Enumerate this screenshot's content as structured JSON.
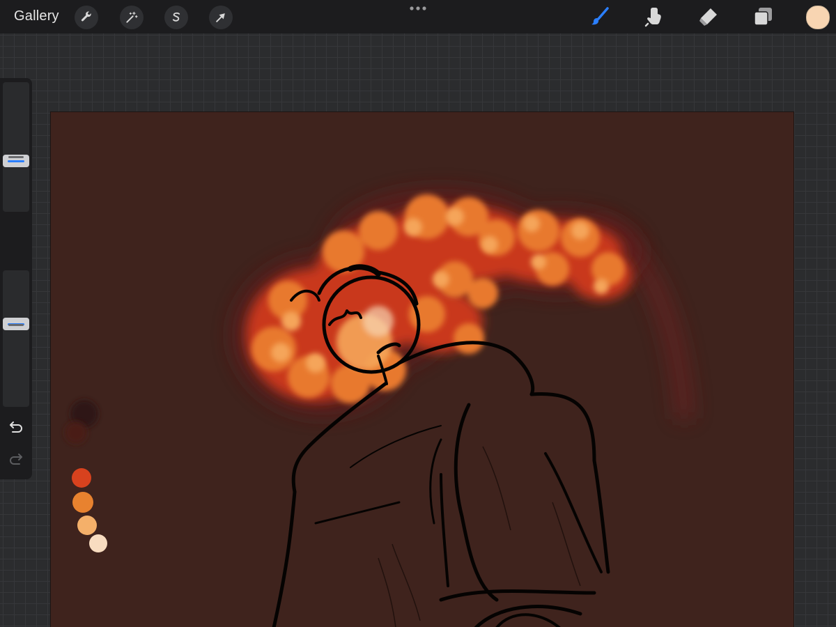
{
  "app": {
    "gallery_label": "Gallery"
  },
  "toolbar": {
    "left_buttons": [
      {
        "name": "actions",
        "icon": "wrench-icon"
      },
      {
        "name": "adjustments",
        "icon": "magic-wand-icon"
      },
      {
        "name": "selection",
        "icon": "selection-s-icon"
      },
      {
        "name": "transform",
        "icon": "arrow-cursor-icon"
      }
    ],
    "right_tools": [
      {
        "name": "brush",
        "icon": "brush-icon",
        "active": true
      },
      {
        "name": "smudge",
        "icon": "smudge-finger-icon",
        "active": false
      },
      {
        "name": "eraser",
        "icon": "eraser-icon",
        "active": false
      },
      {
        "name": "layers",
        "icon": "layers-icon",
        "active": false
      }
    ],
    "current_color": "#f8d5b2"
  },
  "sidebar": {
    "brush_size_level": 0.38,
    "opacity_level": 0.62,
    "modify_button_icon": "square-icon",
    "undo_icon": "undo-icon",
    "redo_icon": "redo-icon"
  },
  "colors": {
    "accent": "#2b7fff",
    "canvas_background": "#3f231d",
    "flame_colors": [
      "#c9391a",
      "#e8792f",
      "#f5a55a",
      "#f8d5b2"
    ],
    "palette_swatches": [
      "#2f1512",
      "#4a1a16",
      "#d8421e",
      "#e8822f",
      "#f4b06a",
      "#f8dcc0"
    ]
  }
}
